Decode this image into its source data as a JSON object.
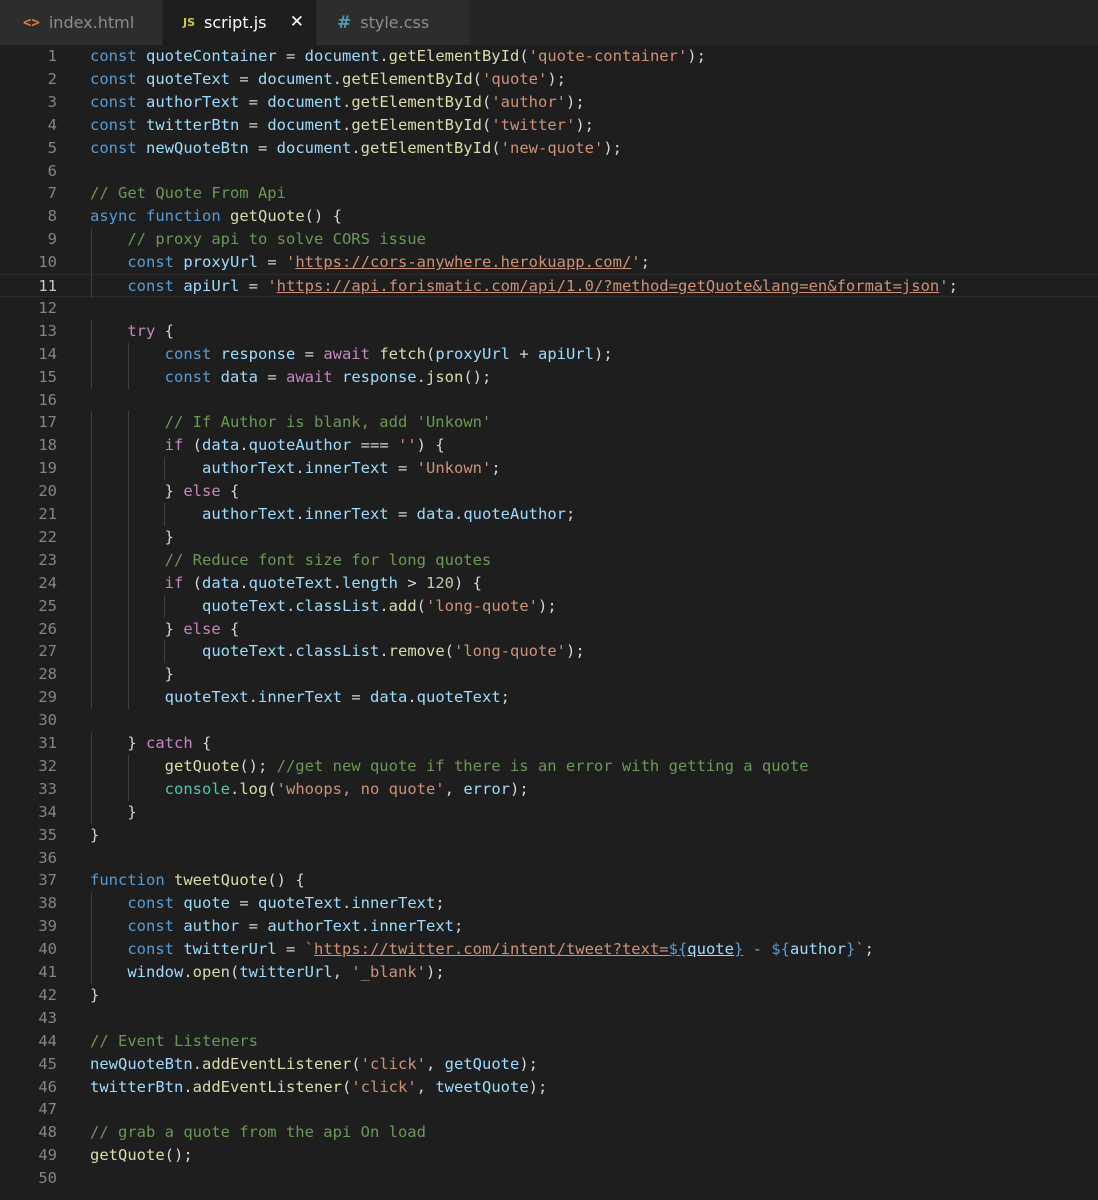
{
  "tabs": [
    {
      "label": "index.html",
      "icon": "html-file-icon",
      "icon_glyph": "<>",
      "active": false
    },
    {
      "label": "script.js",
      "icon": "js-file-icon",
      "icon_glyph": "JS",
      "active": true
    },
    {
      "label": "style.css",
      "icon": "css-file-icon",
      "icon_glyph": "#",
      "active": false
    }
  ],
  "close_glyph": "✕",
  "current_line": 11,
  "code_lines": [
    [
      [
        "k",
        "const "
      ],
      [
        "v",
        "quoteContainer"
      ],
      [
        "p",
        " = "
      ],
      [
        "v",
        "document"
      ],
      [
        "p",
        "."
      ],
      [
        "f",
        "getElementById"
      ],
      [
        "p",
        "("
      ],
      [
        "s",
        "'quote-container'"
      ],
      [
        "p",
        ");"
      ]
    ],
    [
      [
        "k",
        "const "
      ],
      [
        "v",
        "quoteText"
      ],
      [
        "p",
        " = "
      ],
      [
        "v",
        "document"
      ],
      [
        "p",
        "."
      ],
      [
        "f",
        "getElementById"
      ],
      [
        "p",
        "("
      ],
      [
        "s",
        "'quote'"
      ],
      [
        "p",
        ");"
      ]
    ],
    [
      [
        "k",
        "const "
      ],
      [
        "v",
        "authorText"
      ],
      [
        "p",
        " = "
      ],
      [
        "v",
        "document"
      ],
      [
        "p",
        "."
      ],
      [
        "f",
        "getElementById"
      ],
      [
        "p",
        "("
      ],
      [
        "s",
        "'author'"
      ],
      [
        "p",
        ");"
      ]
    ],
    [
      [
        "k",
        "const "
      ],
      [
        "v",
        "twitterBtn"
      ],
      [
        "p",
        " = "
      ],
      [
        "v",
        "document"
      ],
      [
        "p",
        "."
      ],
      [
        "f",
        "getElementById"
      ],
      [
        "p",
        "("
      ],
      [
        "s",
        "'twitter'"
      ],
      [
        "p",
        ");"
      ]
    ],
    [
      [
        "k",
        "const "
      ],
      [
        "v",
        "newQuoteBtn"
      ],
      [
        "p",
        " = "
      ],
      [
        "v",
        "document"
      ],
      [
        "p",
        "."
      ],
      [
        "f",
        "getElementById"
      ],
      [
        "p",
        "("
      ],
      [
        "s",
        "'new-quote'"
      ],
      [
        "p",
        ");"
      ]
    ],
    [],
    [
      [
        "cm",
        "// Get Quote From Api"
      ]
    ],
    [
      [
        "k",
        "async "
      ],
      [
        "k",
        "function "
      ],
      [
        "f",
        "getQuote"
      ],
      [
        "p",
        "() {"
      ]
    ],
    [
      [
        "p",
        "    "
      ],
      [
        "cm",
        "// proxy api to solve CORS issue"
      ]
    ],
    [
      [
        "p",
        "    "
      ],
      [
        "k",
        "const "
      ],
      [
        "v",
        "proxyUrl"
      ],
      [
        "p",
        " = "
      ],
      [
        "s",
        "'"
      ],
      [
        "u",
        "https://cors-anywhere.herokuapp.com/"
      ],
      [
        "s",
        "'"
      ],
      [
        "p",
        ";"
      ]
    ],
    [
      [
        "p",
        "    "
      ],
      [
        "k",
        "const "
      ],
      [
        "v",
        "apiUrl"
      ],
      [
        "p",
        " = "
      ],
      [
        "s",
        "'"
      ],
      [
        "u",
        "https://api.forismatic.com/api/1.0/?method=getQuote&lang=en&format=json"
      ],
      [
        "s",
        "'"
      ],
      [
        "p",
        ";"
      ]
    ],
    [],
    [
      [
        "p",
        "    "
      ],
      [
        "c",
        "try "
      ],
      [
        "p",
        "{"
      ]
    ],
    [
      [
        "p",
        "        "
      ],
      [
        "k",
        "const "
      ],
      [
        "v",
        "response"
      ],
      [
        "p",
        " = "
      ],
      [
        "c",
        "await "
      ],
      [
        "f",
        "fetch"
      ],
      [
        "p",
        "("
      ],
      [
        "v",
        "proxyUrl"
      ],
      [
        "p",
        " + "
      ],
      [
        "v",
        "apiUrl"
      ],
      [
        "p",
        ");"
      ]
    ],
    [
      [
        "p",
        "        "
      ],
      [
        "k",
        "const "
      ],
      [
        "v",
        "data"
      ],
      [
        "p",
        " = "
      ],
      [
        "c",
        "await "
      ],
      [
        "v",
        "response"
      ],
      [
        "p",
        "."
      ],
      [
        "f",
        "json"
      ],
      [
        "p",
        "();"
      ]
    ],
    [],
    [
      [
        "p",
        "        "
      ],
      [
        "cm",
        "// If Author is blank, add 'Unkown'"
      ]
    ],
    [
      [
        "p",
        "        "
      ],
      [
        "c",
        "if "
      ],
      [
        "p",
        "("
      ],
      [
        "v",
        "data"
      ],
      [
        "p",
        "."
      ],
      [
        "v",
        "quoteAuthor"
      ],
      [
        "p",
        " === "
      ],
      [
        "s",
        "''"
      ],
      [
        "p",
        ") {"
      ]
    ],
    [
      [
        "p",
        "            "
      ],
      [
        "v",
        "authorText"
      ],
      [
        "p",
        "."
      ],
      [
        "v",
        "innerText"
      ],
      [
        "p",
        " = "
      ],
      [
        "s",
        "'Unkown'"
      ],
      [
        "p",
        ";"
      ]
    ],
    [
      [
        "p",
        "        } "
      ],
      [
        "c",
        "else "
      ],
      [
        "p",
        "{"
      ]
    ],
    [
      [
        "p",
        "            "
      ],
      [
        "v",
        "authorText"
      ],
      [
        "p",
        "."
      ],
      [
        "v",
        "innerText"
      ],
      [
        "p",
        " = "
      ],
      [
        "v",
        "data"
      ],
      [
        "p",
        "."
      ],
      [
        "v",
        "quoteAuthor"
      ],
      [
        "p",
        ";"
      ]
    ],
    [
      [
        "p",
        "        }"
      ]
    ],
    [
      [
        "p",
        "        "
      ],
      [
        "cm",
        "// Reduce font size for long quotes"
      ]
    ],
    [
      [
        "p",
        "        "
      ],
      [
        "c",
        "if "
      ],
      [
        "p",
        "("
      ],
      [
        "v",
        "data"
      ],
      [
        "p",
        "."
      ],
      [
        "v",
        "quoteText"
      ],
      [
        "p",
        "."
      ],
      [
        "v",
        "length"
      ],
      [
        "p",
        " > "
      ],
      [
        "n",
        "120"
      ],
      [
        "p",
        ") {"
      ]
    ],
    [
      [
        "p",
        "            "
      ],
      [
        "v",
        "quoteText"
      ],
      [
        "p",
        "."
      ],
      [
        "v",
        "classList"
      ],
      [
        "p",
        "."
      ],
      [
        "f",
        "add"
      ],
      [
        "p",
        "("
      ],
      [
        "s",
        "'long-quote'"
      ],
      [
        "p",
        ");"
      ]
    ],
    [
      [
        "p",
        "        } "
      ],
      [
        "c",
        "else "
      ],
      [
        "p",
        "{"
      ]
    ],
    [
      [
        "p",
        "            "
      ],
      [
        "v",
        "quoteText"
      ],
      [
        "p",
        "."
      ],
      [
        "v",
        "classList"
      ],
      [
        "p",
        "."
      ],
      [
        "f",
        "remove"
      ],
      [
        "p",
        "("
      ],
      [
        "s",
        "'long-quote'"
      ],
      [
        "p",
        ");"
      ]
    ],
    [
      [
        "p",
        "        }"
      ]
    ],
    [
      [
        "p",
        "        "
      ],
      [
        "v",
        "quoteText"
      ],
      [
        "p",
        "."
      ],
      [
        "v",
        "innerText"
      ],
      [
        "p",
        " = "
      ],
      [
        "v",
        "data"
      ],
      [
        "p",
        "."
      ],
      [
        "v",
        "quoteText"
      ],
      [
        "p",
        ";"
      ]
    ],
    [],
    [
      [
        "p",
        "    } "
      ],
      [
        "c",
        "catch "
      ],
      [
        "p",
        "{"
      ]
    ],
    [
      [
        "p",
        "        "
      ],
      [
        "f",
        "getQuote"
      ],
      [
        "p",
        "(); "
      ],
      [
        "cm",
        "//get new quote if there is an error with getting a quote"
      ]
    ],
    [
      [
        "p",
        "        "
      ],
      [
        "t",
        "console"
      ],
      [
        "p",
        "."
      ],
      [
        "f",
        "log"
      ],
      [
        "p",
        "("
      ],
      [
        "s",
        "'whoops, no quote'"
      ],
      [
        "p",
        ", "
      ],
      [
        "v",
        "error"
      ],
      [
        "p",
        ");"
      ]
    ],
    [
      [
        "p",
        "    }"
      ]
    ],
    [
      [
        "p",
        "}"
      ]
    ],
    [],
    [
      [
        "k",
        "function "
      ],
      [
        "f",
        "tweetQuote"
      ],
      [
        "p",
        "() {"
      ]
    ],
    [
      [
        "p",
        "    "
      ],
      [
        "k",
        "const "
      ],
      [
        "v",
        "quote"
      ],
      [
        "p",
        " = "
      ],
      [
        "v",
        "quoteText"
      ],
      [
        "p",
        "."
      ],
      [
        "v",
        "innerText"
      ],
      [
        "p",
        ";"
      ]
    ],
    [
      [
        "p",
        "    "
      ],
      [
        "k",
        "const "
      ],
      [
        "v",
        "author"
      ],
      [
        "p",
        " = "
      ],
      [
        "v",
        "authorText"
      ],
      [
        "p",
        "."
      ],
      [
        "v",
        "innerText"
      ],
      [
        "p",
        ";"
      ]
    ],
    [
      [
        "p",
        "    "
      ],
      [
        "k",
        "const "
      ],
      [
        "v",
        "twitterUrl"
      ],
      [
        "p",
        " = "
      ],
      [
        "s",
        "`"
      ],
      [
        "u",
        "https://twitter.com/intent/tweet?text="
      ],
      [
        "tu",
        "${"
      ],
      [
        "tv",
        "quote"
      ],
      [
        "tu",
        "}"
      ],
      [
        "s",
        " - "
      ],
      [
        "k",
        "${"
      ],
      [
        "v",
        "author"
      ],
      [
        "k",
        "}"
      ],
      [
        "s",
        "`"
      ],
      [
        "p",
        ";"
      ]
    ],
    [
      [
        "p",
        "    "
      ],
      [
        "v",
        "window"
      ],
      [
        "p",
        "."
      ],
      [
        "f",
        "open"
      ],
      [
        "p",
        "("
      ],
      [
        "v",
        "twitterUrl"
      ],
      [
        "p",
        ", "
      ],
      [
        "s",
        "'_blank'"
      ],
      [
        "p",
        ");"
      ]
    ],
    [
      [
        "p",
        "}"
      ]
    ],
    [],
    [
      [
        "cm",
        "// Event Listeners"
      ]
    ],
    [
      [
        "v",
        "newQuoteBtn"
      ],
      [
        "p",
        "."
      ],
      [
        "f",
        "addEventListener"
      ],
      [
        "p",
        "("
      ],
      [
        "s",
        "'click'"
      ],
      [
        "p",
        ", "
      ],
      [
        "v",
        "getQuote"
      ],
      [
        "p",
        ");"
      ]
    ],
    [
      [
        "v",
        "twitterBtn"
      ],
      [
        "p",
        "."
      ],
      [
        "f",
        "addEventListener"
      ],
      [
        "p",
        "("
      ],
      [
        "s",
        "'click'"
      ],
      [
        "p",
        ", "
      ],
      [
        "v",
        "tweetQuote"
      ],
      [
        "p",
        ");"
      ]
    ],
    [],
    [
      [
        "cm",
        "// grab a quote from the api On load"
      ]
    ],
    [
      [
        "f",
        "getQuote"
      ],
      [
        "p",
        "();"
      ]
    ],
    []
  ]
}
